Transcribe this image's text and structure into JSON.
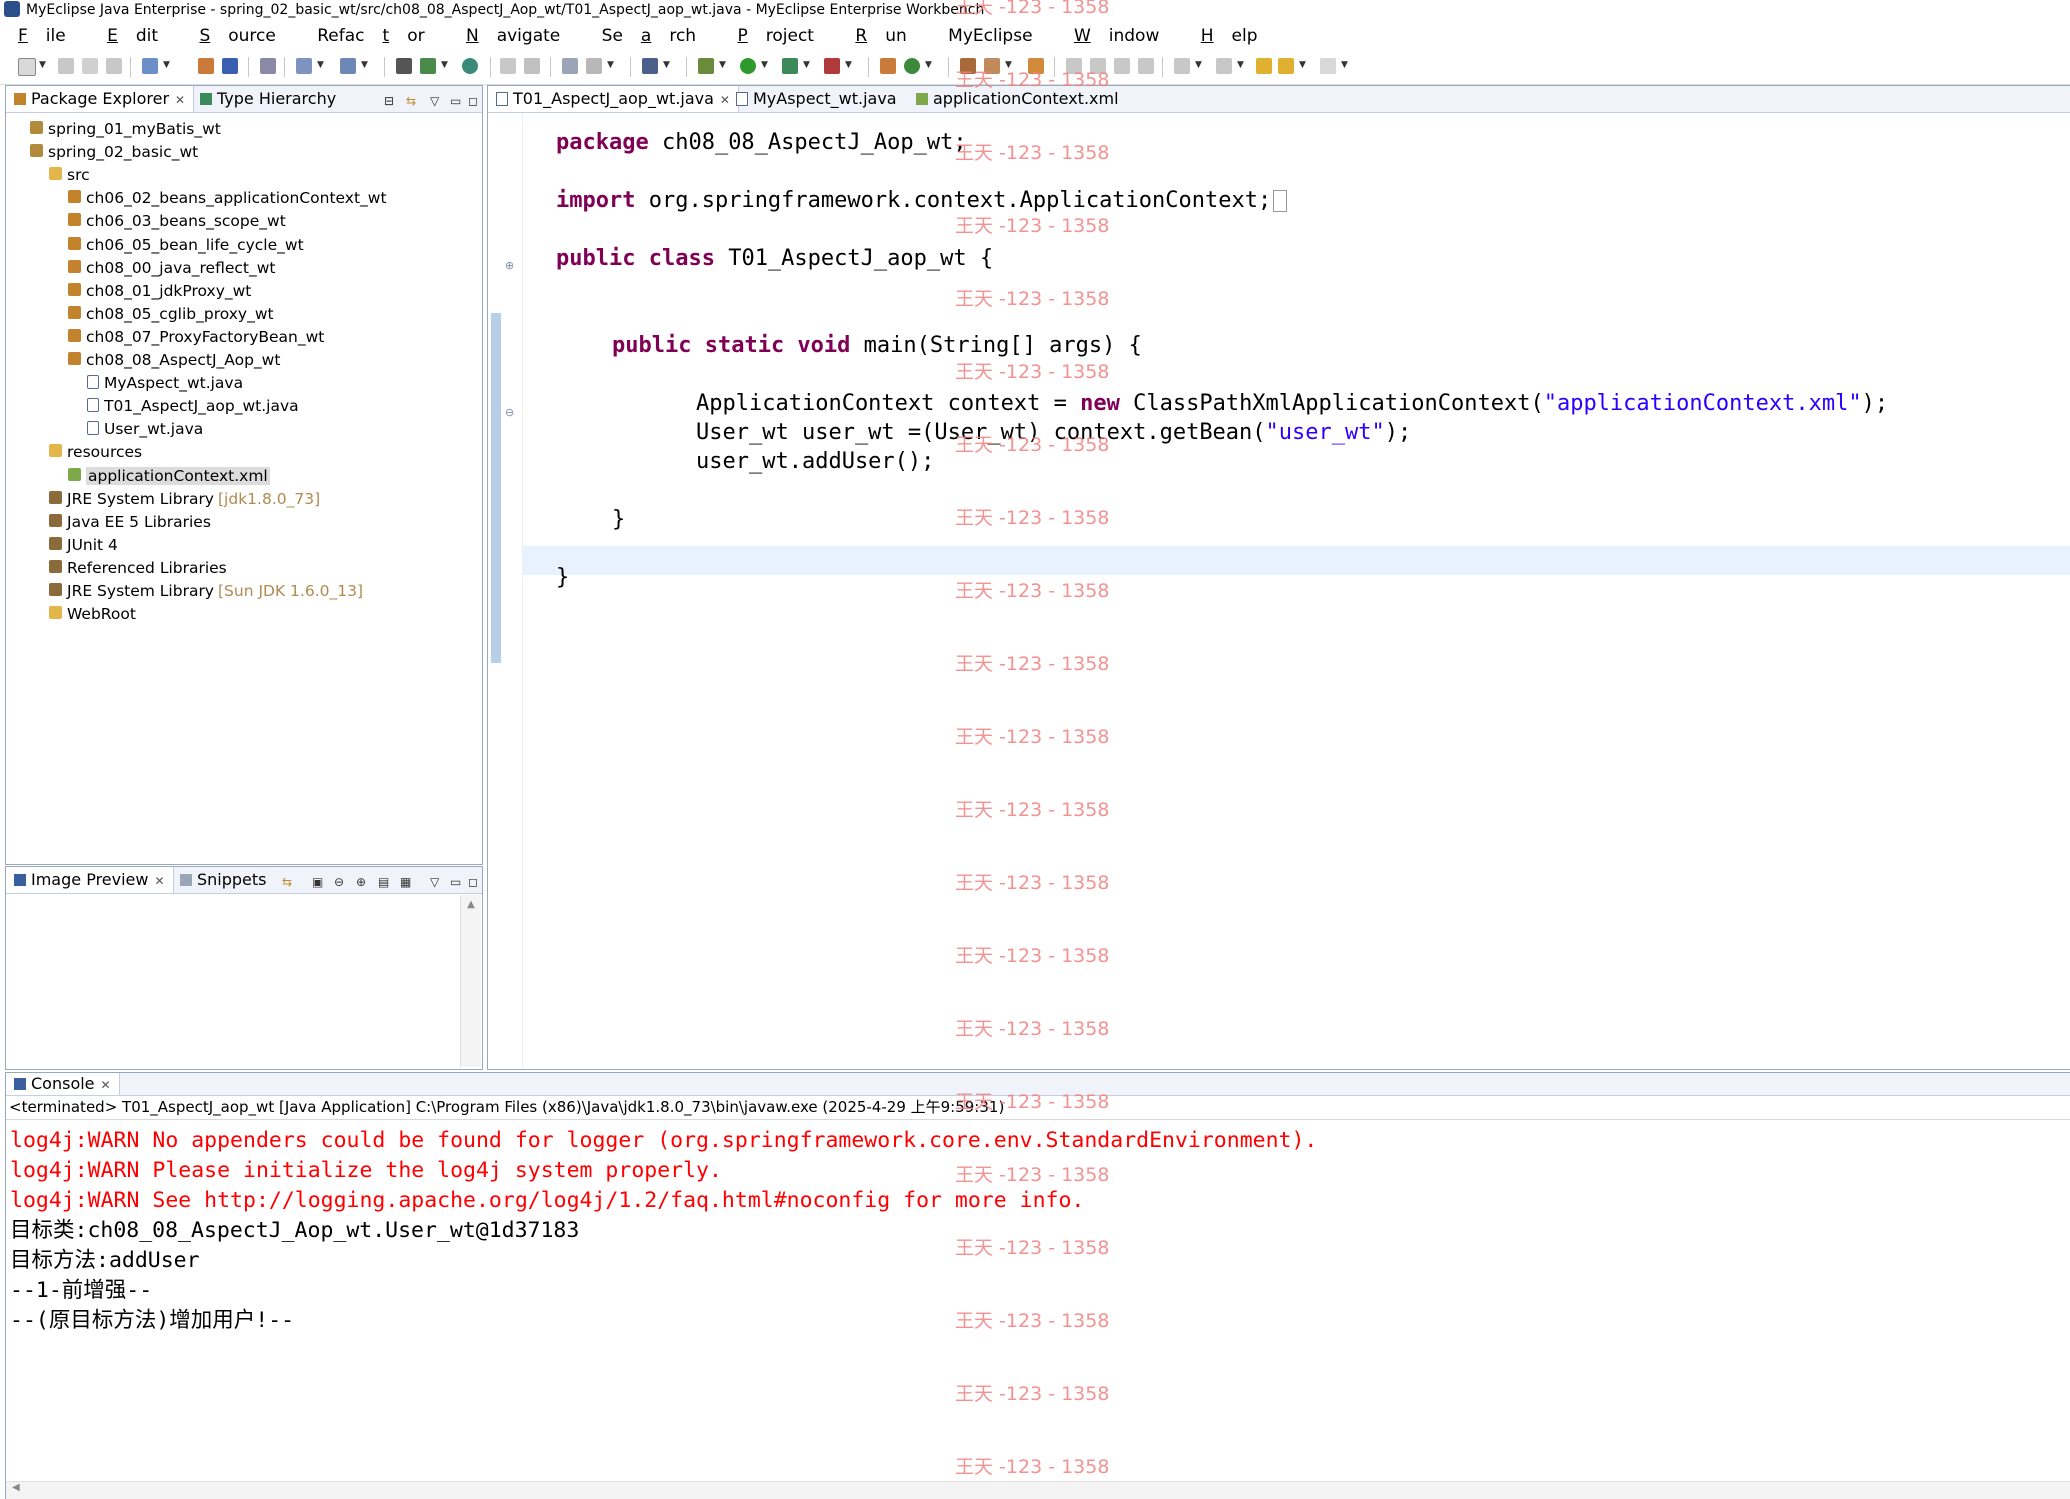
{
  "window": {
    "title": "MyEclipse Java Enterprise - spring_02_basic_wt/src/ch08_08_AspectJ_Aop_wt/T01_AspectJ_aop_wt.java - MyEclipse Enterprise Workbench"
  },
  "menu": {
    "items": [
      {
        "mn": "F",
        "rest": "ile"
      },
      {
        "mn": "E",
        "rest": "dit"
      },
      {
        "mn": "S",
        "rest": "ource"
      },
      {
        "mn": "",
        "rest": "Refac",
        "mn2": "t",
        "rest2": "or"
      },
      {
        "mn": "N",
        "rest": "avigate"
      },
      {
        "mn": "",
        "rest": "Se",
        "mn2": "a",
        "rest2": "rch"
      },
      {
        "mn": "P",
        "rest": "roject"
      },
      {
        "mn": "R",
        "rest": "un"
      },
      {
        "mn": "",
        "rest": "MyEclipse"
      },
      {
        "mn": "W",
        "rest": "indow"
      },
      {
        "mn": "H",
        "rest": "elp"
      }
    ]
  },
  "explorer": {
    "tabs": [
      "Package Explorer",
      "Type Hierarchy"
    ],
    "tree": [
      {
        "label": "spring_01_myBatis_wt",
        "icon": "project-icon",
        "indent": 0
      },
      {
        "label": "spring_02_basic_wt",
        "icon": "project-icon",
        "indent": 0
      },
      {
        "label": "src",
        "icon": "source-folder-icon",
        "indent": 1
      },
      {
        "label": "ch06_02_beans_applicationContext_wt",
        "icon": "package-icon",
        "indent": 2
      },
      {
        "label": "ch06_03_beans_scope_wt",
        "icon": "package-icon",
        "indent": 2
      },
      {
        "label": "ch06_05_bean_life_cycle_wt",
        "icon": "package-icon",
        "indent": 2
      },
      {
        "label": "ch08_00_java_reflect_wt",
        "icon": "package-icon",
        "indent": 2
      },
      {
        "label": "ch08_01_jdkProxy_wt",
        "icon": "package-icon",
        "indent": 2
      },
      {
        "label": "ch08_05_cglib_proxy_wt",
        "icon": "package-icon",
        "indent": 2
      },
      {
        "label": "ch08_07_ProxyFactoryBean_wt",
        "icon": "package-icon",
        "indent": 2
      },
      {
        "label": "ch08_08_AspectJ_Aop_wt",
        "icon": "package-icon",
        "indent": 2
      },
      {
        "label": "MyAspect_wt.java",
        "icon": "java-file-icon",
        "indent": 3
      },
      {
        "label": "T01_AspectJ_aop_wt.java",
        "icon": "java-file-icon",
        "indent": 3
      },
      {
        "label": "User_wt.java",
        "icon": "java-file-icon",
        "indent": 3
      },
      {
        "label": "resources",
        "icon": "source-folder-icon",
        "indent": 1
      },
      {
        "label": "applicationContext.xml",
        "icon": "xml-file-icon",
        "indent": 2,
        "selected": true
      },
      {
        "label": "JRE System Library",
        "version": "[jdk1.8.0_73]",
        "icon": "library-icon",
        "indent": 1
      },
      {
        "label": "Java EE 5 Libraries",
        "icon": "library-icon",
        "indent": 1
      },
      {
        "label": "JUnit 4",
        "icon": "library-icon",
        "indent": 1
      },
      {
        "label": "Referenced Libraries",
        "icon": "library-icon",
        "indent": 1
      },
      {
        "label": "JRE System Library",
        "version": "[Sun JDK 1.6.0_13]",
        "icon": "library-icon",
        "indent": 1
      },
      {
        "label": "WebRoot",
        "icon": "folder-icon",
        "indent": 1
      }
    ]
  },
  "preview": {
    "tabs": [
      "Image Preview",
      "Snippets"
    ]
  },
  "editor": {
    "tabs": [
      "T01_AspectJ_aop_wt.java",
      "MyAspect_wt.java",
      "applicationContext.xml"
    ],
    "code": {
      "l1_kw": "package",
      "l1_rest": " ch08_08_AspectJ_Aop_wt;",
      "l2_kw": "import",
      "l2_rest": " org.springframework.context.ApplicationContext;",
      "l3_kw": "public class",
      "l3_rest": " T01_AspectJ_aop_wt {",
      "l4_kw": "public static void",
      "l4_rest": " main(String[] args) {",
      "l5_a": "ApplicationContext context = ",
      "l5_kw": "new",
      "l5_b": " ClassPathXmlApplicationContext(",
      "l5_str": "\"applicationContext.xml\"",
      "l5_c": ");",
      "l6_a": "User_wt user_wt =(User_wt) context.getBean(",
      "l6_str": "\"user_wt\"",
      "l6_c": ");",
      "l7": "user_wt.addUser();",
      "l8": "}",
      "l9": "}"
    }
  },
  "console": {
    "tab": "Console",
    "status": "<terminated> T01_AspectJ_aop_wt [Java Application] C:\\Program Files (x86)\\Java\\jdk1.8.0_73\\bin\\javaw.exe (2025-4-29 上午9:59:31)",
    "lines": [
      {
        "text": "log4j:WARN No appenders could be found for logger (org.springframework.core.env.StandardEnvironment).",
        "color": "#ff0000"
      },
      {
        "text": "log4j:WARN Please initialize the log4j system properly.",
        "color": "#ff0000"
      },
      {
        "text": "log4j:WARN See http://logging.apache.org/log4j/1.2/faq.html#noconfig for more info.",
        "color": "#ff0000"
      },
      {
        "text": "目标类:ch08_08_AspectJ_Aop_wt.User_wt@1d37183",
        "color": "#000000"
      },
      {
        "text": "目标方法:addUser",
        "color": "#000000"
      },
      {
        "text": "--1-前增强--",
        "color": "#000000"
      },
      {
        "text": "--(原目标方法)增加用户!--",
        "color": "#000000"
      }
    ]
  },
  "watermark": "王天 -123 - 1358"
}
